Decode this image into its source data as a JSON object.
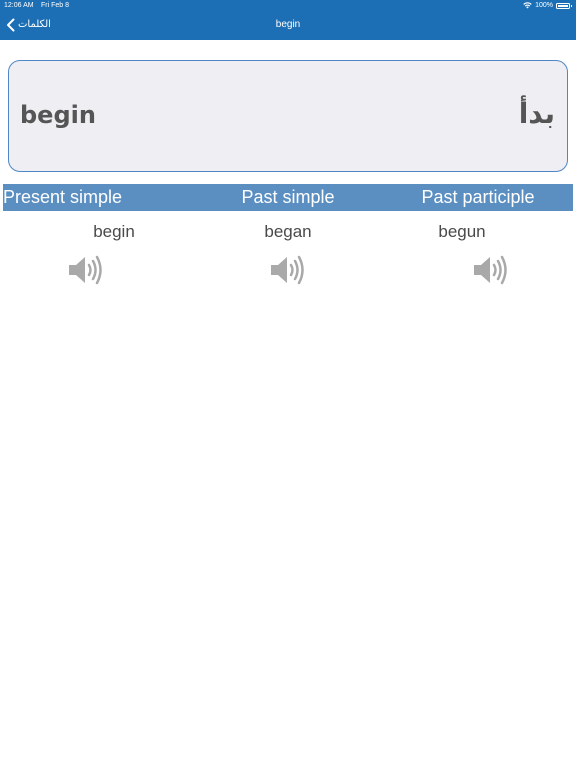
{
  "status_bar": {
    "time": "12:06 AM",
    "date": "Fri Feb 8",
    "battery": "100%",
    "wifi_icon": "wifi-icon",
    "battery_icon": "battery-icon"
  },
  "nav": {
    "back_label": "الكلمات",
    "back_icon": "chevron-left-icon",
    "title": "begin"
  },
  "word": {
    "english": "begin",
    "arabic": "بدأ"
  },
  "forms": {
    "headers": [
      "Present simple",
      "Past simple",
      "Past participle"
    ],
    "values": [
      "begin",
      "began",
      "begun"
    ],
    "audio_icon": "speaker-icon"
  },
  "colors": {
    "nav_background": "#1d6fb5",
    "header_background": "#5b8fc2",
    "card_background": "#eeeef3",
    "card_border": "#4f86c6",
    "icon_gray": "#a9a9a9"
  }
}
